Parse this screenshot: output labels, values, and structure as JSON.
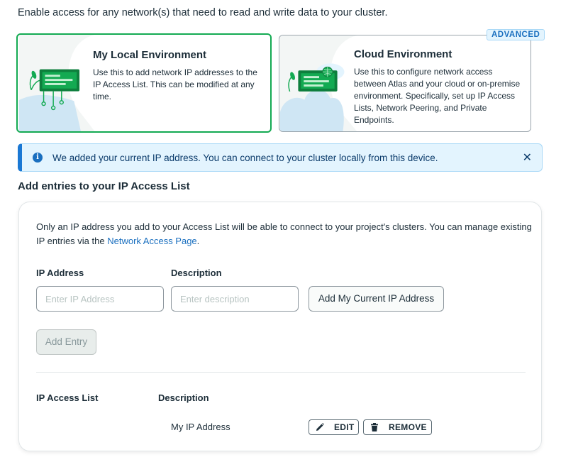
{
  "intro_text": "Enable access for any network(s) that need to read and write data to your cluster.",
  "cards": {
    "local": {
      "title": "My Local Environment",
      "description": "Use this to add network IP addresses to the IP Access List. This can be modified at any time."
    },
    "cloud": {
      "badge": "ADVANCED",
      "title": "Cloud Environment",
      "description": "Use this to configure network access between Atlas and your cloud or on-premise environment. Specifically, set up IP Access Lists, Network Peering, and Private Endpoints."
    }
  },
  "banner": {
    "message": "We added your current IP address. You can connect to your cluster locally from this device.",
    "close_glyph": "✕"
  },
  "section_title": "Add entries to your IP Access List",
  "panel": {
    "description_pre": "Only an IP address you add to your Access List will be able to connect to your project's clusters. You can manage existing IP entries via the ",
    "link_text": "Network Access Page",
    "description_post": ".",
    "ip_label": "IP Address",
    "ip_placeholder": "Enter IP Address",
    "desc_label": "Description",
    "desc_placeholder": "Enter description",
    "add_current_ip_label": "Add My Current IP Address",
    "add_entry_label": "Add Entry"
  },
  "table": {
    "headers": [
      "IP Access List",
      "Description"
    ],
    "rows": [
      {
        "ip": "",
        "description": "My IP Address",
        "edit_label": "EDIT",
        "remove_label": "REMOVE"
      }
    ]
  },
  "colors": {
    "accent_green": "#13aa52",
    "link_blue": "#1a6fbf",
    "banner_bg": "#e3f4fe"
  }
}
